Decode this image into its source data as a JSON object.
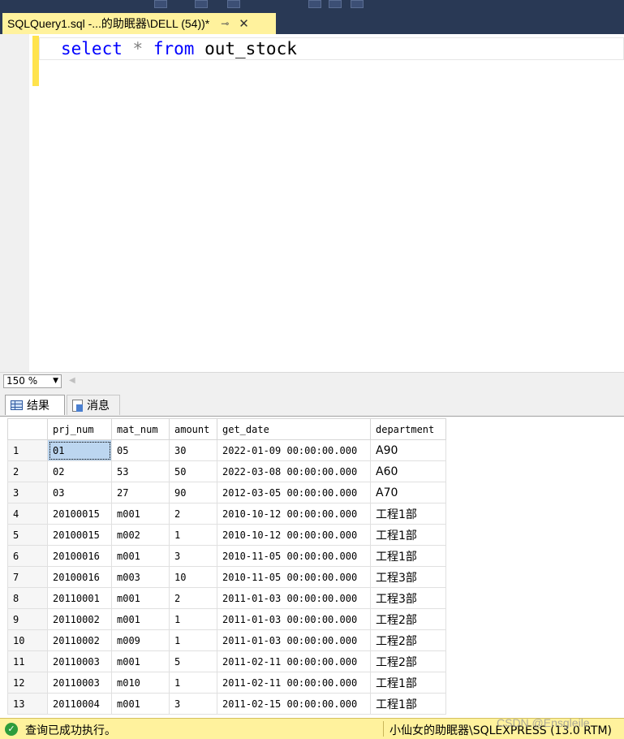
{
  "tab": {
    "title": "SQLQuery1.sql -...的助眠器\\DELL (54))*",
    "pin": "⊸",
    "close": "✕"
  },
  "editor": {
    "keyword_select": "select",
    "star": "*",
    "keyword_from": "from",
    "table_name": "out_stock"
  },
  "zoom": {
    "value": "150 %"
  },
  "results_tabs": {
    "results": "结果",
    "messages": "消息"
  },
  "grid": {
    "columns": [
      "prj_num",
      "mat_num",
      "amount",
      "get_date",
      "department"
    ],
    "rows": [
      [
        "1",
        "01",
        "05",
        "30",
        "2022-01-09 00:00:00.000",
        "A90"
      ],
      [
        "2",
        "02",
        "53",
        "50",
        "2022-03-08 00:00:00.000",
        "A60"
      ],
      [
        "3",
        "03",
        "27",
        "90",
        "2012-03-05 00:00:00.000",
        "A70"
      ],
      [
        "4",
        "20100015",
        "m001",
        "2",
        "2010-10-12 00:00:00.000",
        "工程1部"
      ],
      [
        "5",
        "20100015",
        "m002",
        "1",
        "2010-10-12 00:00:00.000",
        "工程1部"
      ],
      [
        "6",
        "20100016",
        "m001",
        "3",
        "2010-11-05 00:00:00.000",
        "工程1部"
      ],
      [
        "7",
        "20100016",
        "m003",
        "10",
        "2010-11-05 00:00:00.000",
        "工程3部"
      ],
      [
        "8",
        "20110001",
        "m001",
        "2",
        "2011-01-03 00:00:00.000",
        "工程3部"
      ],
      [
        "9",
        "20110002",
        "m001",
        "1",
        "2011-01-03 00:00:00.000",
        "工程2部"
      ],
      [
        "10",
        "20110002",
        "m009",
        "1",
        "2011-01-03 00:00:00.000",
        "工程2部"
      ],
      [
        "11",
        "20110003",
        "m001",
        "5",
        "2011-02-11 00:00:00.000",
        "工程2部"
      ],
      [
        "12",
        "20110003",
        "m010",
        "1",
        "2011-02-11 00:00:00.000",
        "工程1部"
      ],
      [
        "13",
        "20110004",
        "m001",
        "3",
        "2011-02-15 00:00:00.000",
        "工程1部"
      ]
    ]
  },
  "status": {
    "message": "查询已成功执行。",
    "server": "小仙女的助眠器\\SQLEXPRESS (13.0 RTM)"
  },
  "watermark": "CSDN @Ensgleile"
}
